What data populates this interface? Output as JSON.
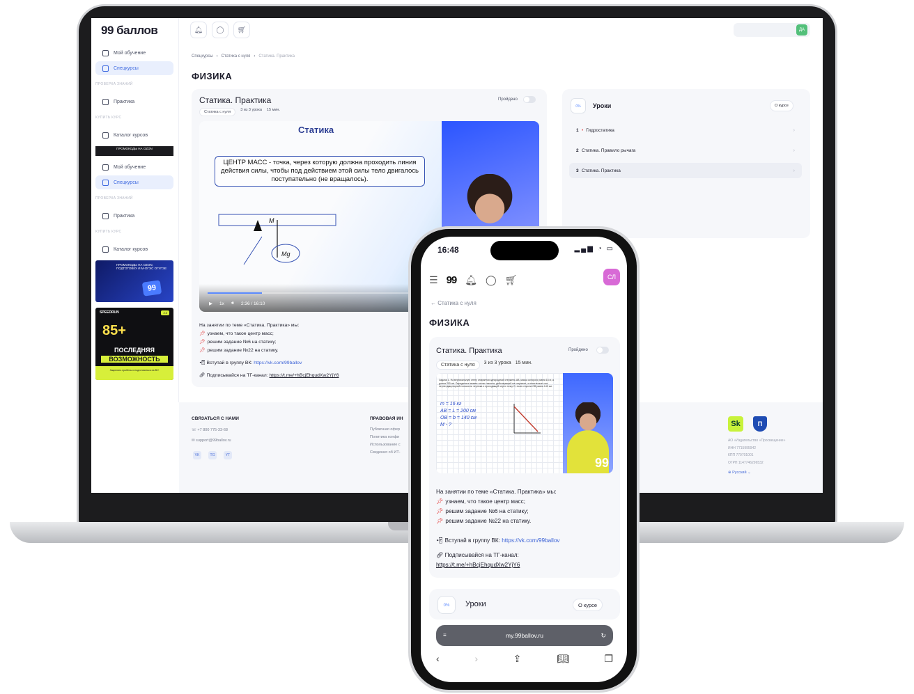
{
  "app": {
    "logo": "99 баллов"
  },
  "sidebar": {
    "items": [
      {
        "label": "Мой обучение"
      },
      {
        "label": "Спецкурсы"
      },
      {
        "label": "Практика"
      },
      {
        "label": "Каталог курсов"
      },
      {
        "label": "Мой обучение"
      },
      {
        "label": "Спецкурсы"
      },
      {
        "label": "Практика"
      },
      {
        "label": "Каталог курсов"
      }
    ],
    "sections": [
      "ПРОВЕРКА ЗНАНИЙ",
      "КУПИТЬ КУРС",
      "ПРОВЕРКА ЗНАНИЙ",
      "КУПИТЬ КУРС"
    ],
    "promo_bar": "ПРОМОКОДЫ НА OZON",
    "promo_ozon": "ПРОМОКОДЫ НА OZON, ПОДГОТОВКУ И М-ОГЭС ОГУГЭЕ",
    "promo_ozon_badge": "99",
    "promo_speed": {
      "head": "SPEEDRUN",
      "tag": "2.0",
      "score": "85+",
      "line1": "ПОСЛЕДНЯЯ",
      "line2": "ВОЗМОЖНОСТЬ",
      "foot": "Закрепить пробелы и подготовиться на 85+"
    }
  },
  "topbar": {
    "user_initials": "ДА"
  },
  "breadcrumb": [
    "Спецкурсы",
    "Статика с нуля",
    "Статика. Практика"
  ],
  "page_title": "ФИЗИКА",
  "lesson": {
    "title": "Статика. Практика",
    "done_label": "Пройдено",
    "meta": [
      "Статика с нуля",
      "3 из 3 урока",
      "15 мин."
    ],
    "video": {
      "slide_title": "Статика",
      "definition": "ЦЕНТР МАСС - точка, через которую должна проходить линия действия силы, чтобы под действием этой силы тело двигалось поступательно (не вращалось).",
      "diagram_label_m": "M",
      "diagram_label_mg": "Mg",
      "speed": "1x",
      "time": "2:36 / 16:10",
      "progress": 0.26
    },
    "description": {
      "intro": "На занятии по теме «Статика. Практика» мы:",
      "points": [
        "узнаем, что такое центр масс;",
        "решим задание №6 на статику;",
        "решим задание №22 на статику."
      ],
      "vk_text": "Вступай в группу ВК:",
      "vk_link": "https://vk.com/99ballov",
      "tg_text": "Подписывайся на ТГ-канал:",
      "tg_link": "https://t.me/+hBcjEhqudXw2YjY6"
    }
  },
  "lessons_panel": {
    "progress": "0%",
    "title": "Уроки",
    "about": "О курсе",
    "items": [
      {
        "num": "1",
        "title": "Гидростатика"
      },
      {
        "num": "2",
        "title": "Статика. Правило рычага"
      },
      {
        "num": "3",
        "title": "Статика. Практика"
      }
    ]
  },
  "footer": {
    "contact_head": "СВЯЗАТЬСЯ С НАМИ",
    "phone": "+7 800 775-33-68",
    "email": "support@99ballov.ru",
    "social": [
      "VK",
      "TG",
      "YT"
    ],
    "legal_head": "ПРАВОВАЯ ИН",
    "legal_links": [
      "Публичная офер",
      "Политика конфи",
      "Использование с",
      "Сведения об ИТ-"
    ],
    "sk_logo": "Sk",
    "pros_logo": "П",
    "company": [
      "АО «Издательство «Просвещение»",
      "ИНН 7715995942",
      "КПП 770701001",
      "ОГРН 1147746296532"
    ],
    "language": "Русский"
  },
  "phone": {
    "time": "16:48",
    "status": "▂▄▆ ◔ ▭",
    "logo": "99",
    "avatar": "СЛ",
    "back": "Статика с нуля",
    "page_title": "ФИЗИКА",
    "card_title": "Статика. Практика",
    "done_label": "Пройдено",
    "meta": [
      "Статика с нуля",
      "3 из 3 урока",
      "15 мин."
    ],
    "board_text": "Задача 1. На вертикальную стену опирается однородный стержень АВ, масса которого равна 16 кг, а длина 200 см. Определите момент силы тяжести, действующей на стержень, относительно оси, перпендикулярной плоскости чертежа и проходящей через точку О, если сторона ОВ равна 140 см.",
    "formula": [
      "m = 16 кг",
      "AB = L = 200 см",
      "OB = b = 140 см",
      "M - ?"
    ],
    "description": {
      "intro": "На занятии по теме «Статика. Практика» мы:",
      "points": [
        "узнаем, что такое центр масс;",
        "решим задание №6 на статику;",
        "решим задание №22 на статику."
      ],
      "vk_text": "Вступай в группу ВК:",
      "vk_link": "https://vk.com/99ballov",
      "tg_text": "Подписывайся на ТГ-канал:",
      "tg_link": "https://t.me/+hBcjEhqudXw2YjY6"
    },
    "lessons": {
      "progress": "0%",
      "title": "Уроки",
      "about": "О курсе"
    },
    "url": "my.99ballov.ru"
  },
  "colors": {
    "accent": "#3f6ae0",
    "green": "#53c07a",
    "pink": "#d86ad6",
    "bg_panel": "#f6f7fa"
  }
}
